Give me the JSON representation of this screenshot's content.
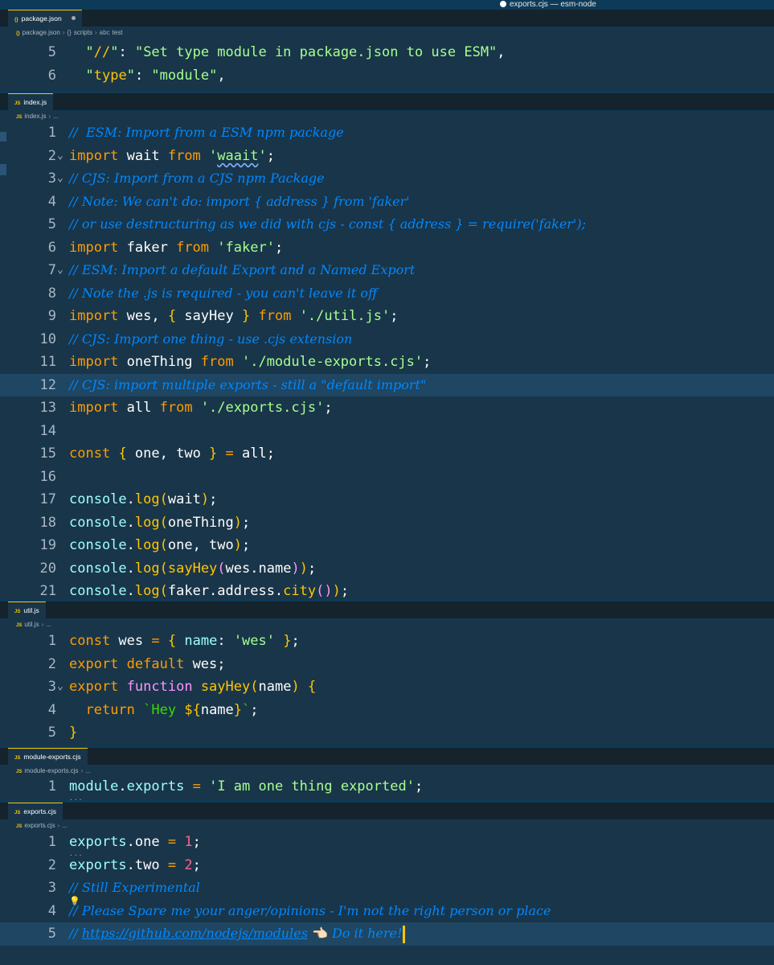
{
  "window": {
    "title": "exports.cjs — esm-node"
  },
  "panes": {
    "package": {
      "tab": "package.json",
      "tab_icon": "{}",
      "crumbs": [
        "package.json",
        "scripts",
        "test"
      ],
      "lines": [
        {
          "n": "5",
          "code": "\"//\": \"Set type module in package.json to use ESM\","
        },
        {
          "n": "6",
          "code": "\"type\": \"module\","
        }
      ]
    },
    "index": {
      "tab": "index.js",
      "tab_icon": "JS",
      "crumbs": [
        "index.js",
        "..."
      ],
      "highlighted_line": "12"
    },
    "util": {
      "tab": "util.js",
      "tab_icon": "JS",
      "crumbs": [
        "util.js",
        "..."
      ]
    },
    "module_exports": {
      "tab": "module-exports.cjs",
      "tab_icon": "JS",
      "crumbs": [
        "module-exports.cjs",
        "..."
      ]
    },
    "exports": {
      "tab": "exports.cjs",
      "tab_icon": "JS",
      "crumbs": [
        "exports.cjs",
        "..."
      ]
    }
  },
  "colors": {
    "background": "#193549",
    "keyword": "#ff9d00",
    "function": "#ffc600",
    "string": "#a5ff90",
    "comment": "#0088ff",
    "number": "#ff628c",
    "object": "#9effff",
    "cursor": "#ffc600"
  },
  "icons": {
    "tab_json": "curly-braces-icon",
    "tab_js": "js-file-icon",
    "lightbulb": "lightbulb-icon",
    "pointing_hand": "pointing-hand-emoji"
  }
}
